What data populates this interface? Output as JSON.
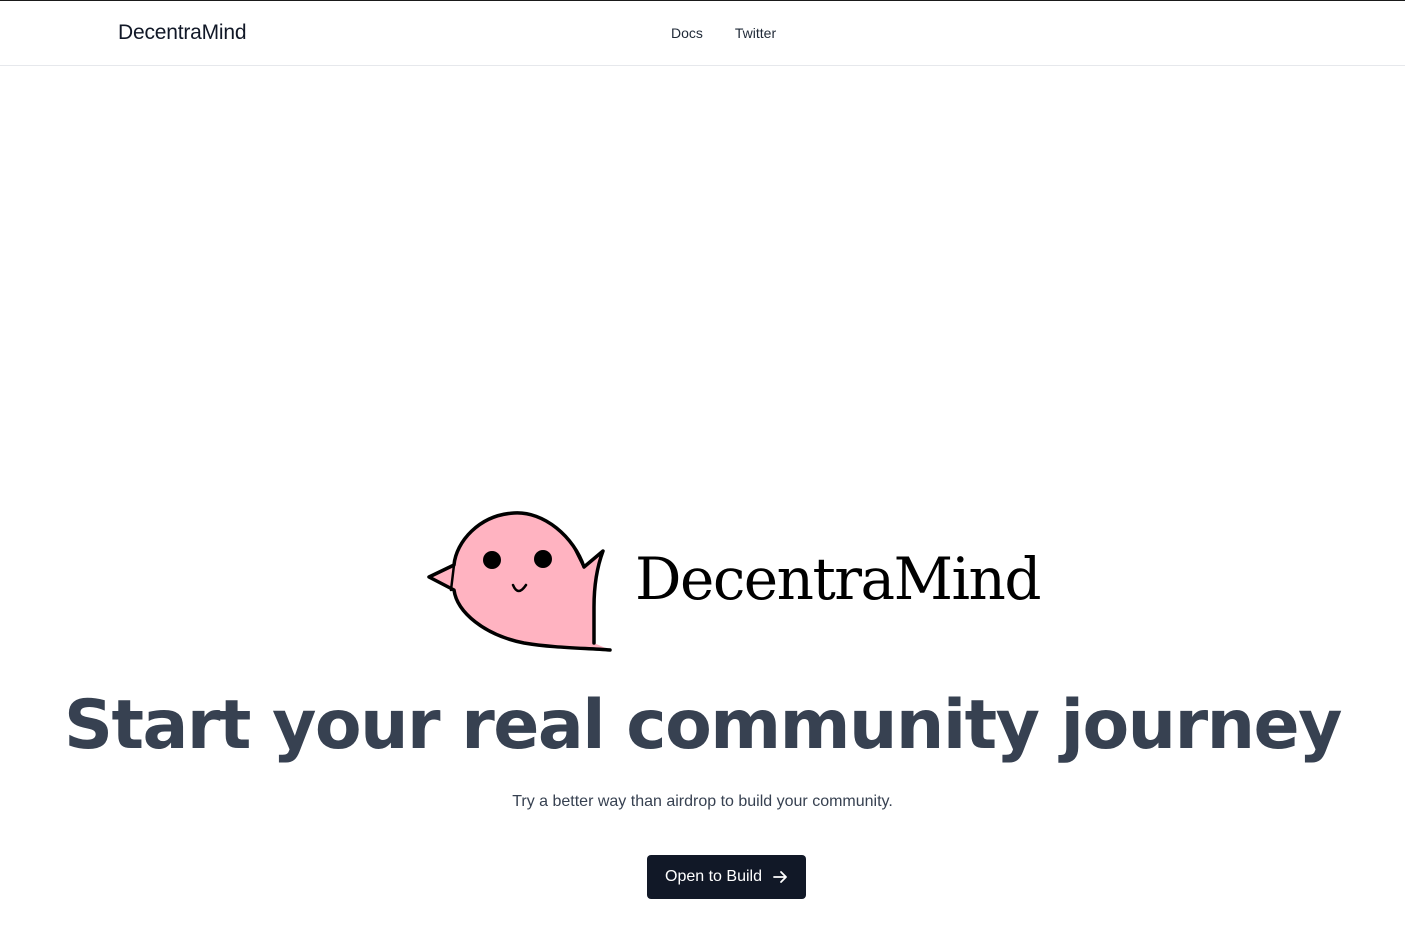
{
  "header": {
    "brand": "DecentraMind",
    "nav": [
      {
        "label": "Docs"
      },
      {
        "label": "Twitter"
      }
    ]
  },
  "hero": {
    "logo_text": "DecentraMind",
    "logo_icon": "pink-ghost-mascot-icon",
    "headline": "Start your real community journey",
    "subheadline": "Try a better way than airdrop to build your community.",
    "cta": {
      "label": "Open to Build",
      "icon": "arrow-right-icon"
    }
  },
  "colors": {
    "mascot_fill": "#FFB3C1",
    "cta_background": "#111827",
    "headline": "#374151"
  }
}
